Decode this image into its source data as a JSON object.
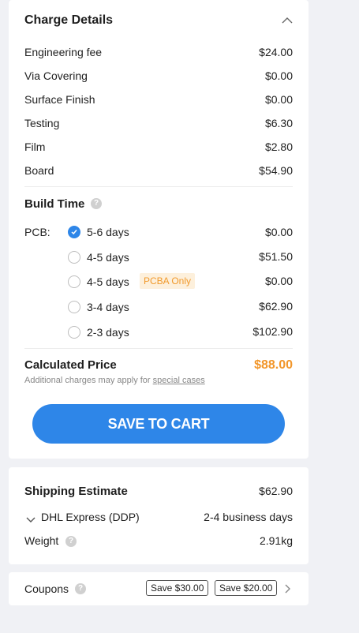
{
  "charge_details": {
    "title": "Charge Details",
    "items": [
      {
        "label": "Engineering fee",
        "value": "$24.00"
      },
      {
        "label": "Via Covering",
        "value": "$0.00"
      },
      {
        "label": "Surface Finish",
        "value": "$0.00"
      },
      {
        "label": "Testing",
        "value": "$6.30"
      },
      {
        "label": "Film",
        "value": "$2.80"
      },
      {
        "label": "Board",
        "value": "$54.90"
      }
    ]
  },
  "build_time": {
    "title": "Build Time",
    "pcb_label": "PCB:",
    "options": [
      {
        "label": "5-6 days",
        "price": "$0.00",
        "selected": true
      },
      {
        "label": "4-5 days",
        "price": "$51.50",
        "selected": false
      },
      {
        "label": "4-5 days",
        "price": "$0.00",
        "selected": false,
        "badge": "PCBA Only"
      },
      {
        "label": "3-4 days",
        "price": "$62.90",
        "selected": false
      },
      {
        "label": "2-3 days",
        "price": "$102.90",
        "selected": false
      }
    ]
  },
  "calculated": {
    "label": "Calculated Price",
    "value": "$88.00",
    "note": "Additional charges may apply for",
    "note_link": "special cases"
  },
  "save_button": "SAVE TO CART",
  "shipping": {
    "title": "Shipping Estimate",
    "price": "$62.90",
    "carrier": "DHL Express (DDP)",
    "time": "2-4 business days",
    "weight_label": "Weight",
    "weight_value": "2.91kg"
  },
  "coupons": {
    "label": "Coupons",
    "tags": [
      "Save $30.00",
      "Save $20.00"
    ]
  },
  "colors": {
    "accent": "#2e86e8",
    "price": "#f2962a",
    "badge_bg": "#fdf0dc"
  }
}
